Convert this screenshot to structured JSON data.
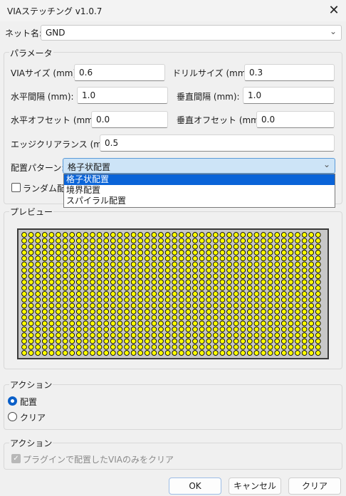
{
  "window": {
    "title": "VIAステッチング v1.0.7",
    "close_glyph": "✕"
  },
  "net": {
    "label": "ネット名:",
    "value": "GND"
  },
  "params": {
    "title": "パラメータ",
    "via_size": {
      "label": "VIAサイズ (mm):",
      "value": "0.6"
    },
    "drill_size": {
      "label": "ドリルサイズ (mm):",
      "value": "0.3"
    },
    "h_spacing": {
      "label": "水平間隔 (mm):",
      "value": "1.0"
    },
    "v_spacing": {
      "label": "垂直間隔 (mm):",
      "value": "1.0"
    },
    "h_offset": {
      "label": "水平オフセット (mm):",
      "value": "0.0"
    },
    "v_offset": {
      "label": "垂直オフセット (mm):",
      "value": "0.0"
    },
    "clearance": {
      "label": "エッジクリアランス (mm):",
      "value": "0.5"
    },
    "pattern": {
      "label": "配置パターン:",
      "value": "格子状配置",
      "options": [
        "格子状配置",
        "境界配置",
        "スパイラル配置"
      ],
      "selected_index": 0
    },
    "random": {
      "label": "ランダム配置",
      "checked": false
    }
  },
  "preview": {
    "title": "プレビュー",
    "rows": 21,
    "cols": 44,
    "via_color": "#ffff00",
    "background": "#c8c8c8"
  },
  "action": {
    "title": "アクション",
    "options": [
      {
        "label": "配置",
        "selected": true
      },
      {
        "label": "クリア",
        "selected": false
      }
    ]
  },
  "action2": {
    "title": "アクション",
    "checkbox": {
      "label": "プラグインで配置したVIAのみをクリア",
      "checked": true,
      "disabled": true
    }
  },
  "buttons": {
    "ok": "OK",
    "cancel": "キャンセル",
    "clear": "クリア"
  },
  "colors": {
    "accent": "#0a64d8",
    "window_bg": "#f0f0f0"
  }
}
